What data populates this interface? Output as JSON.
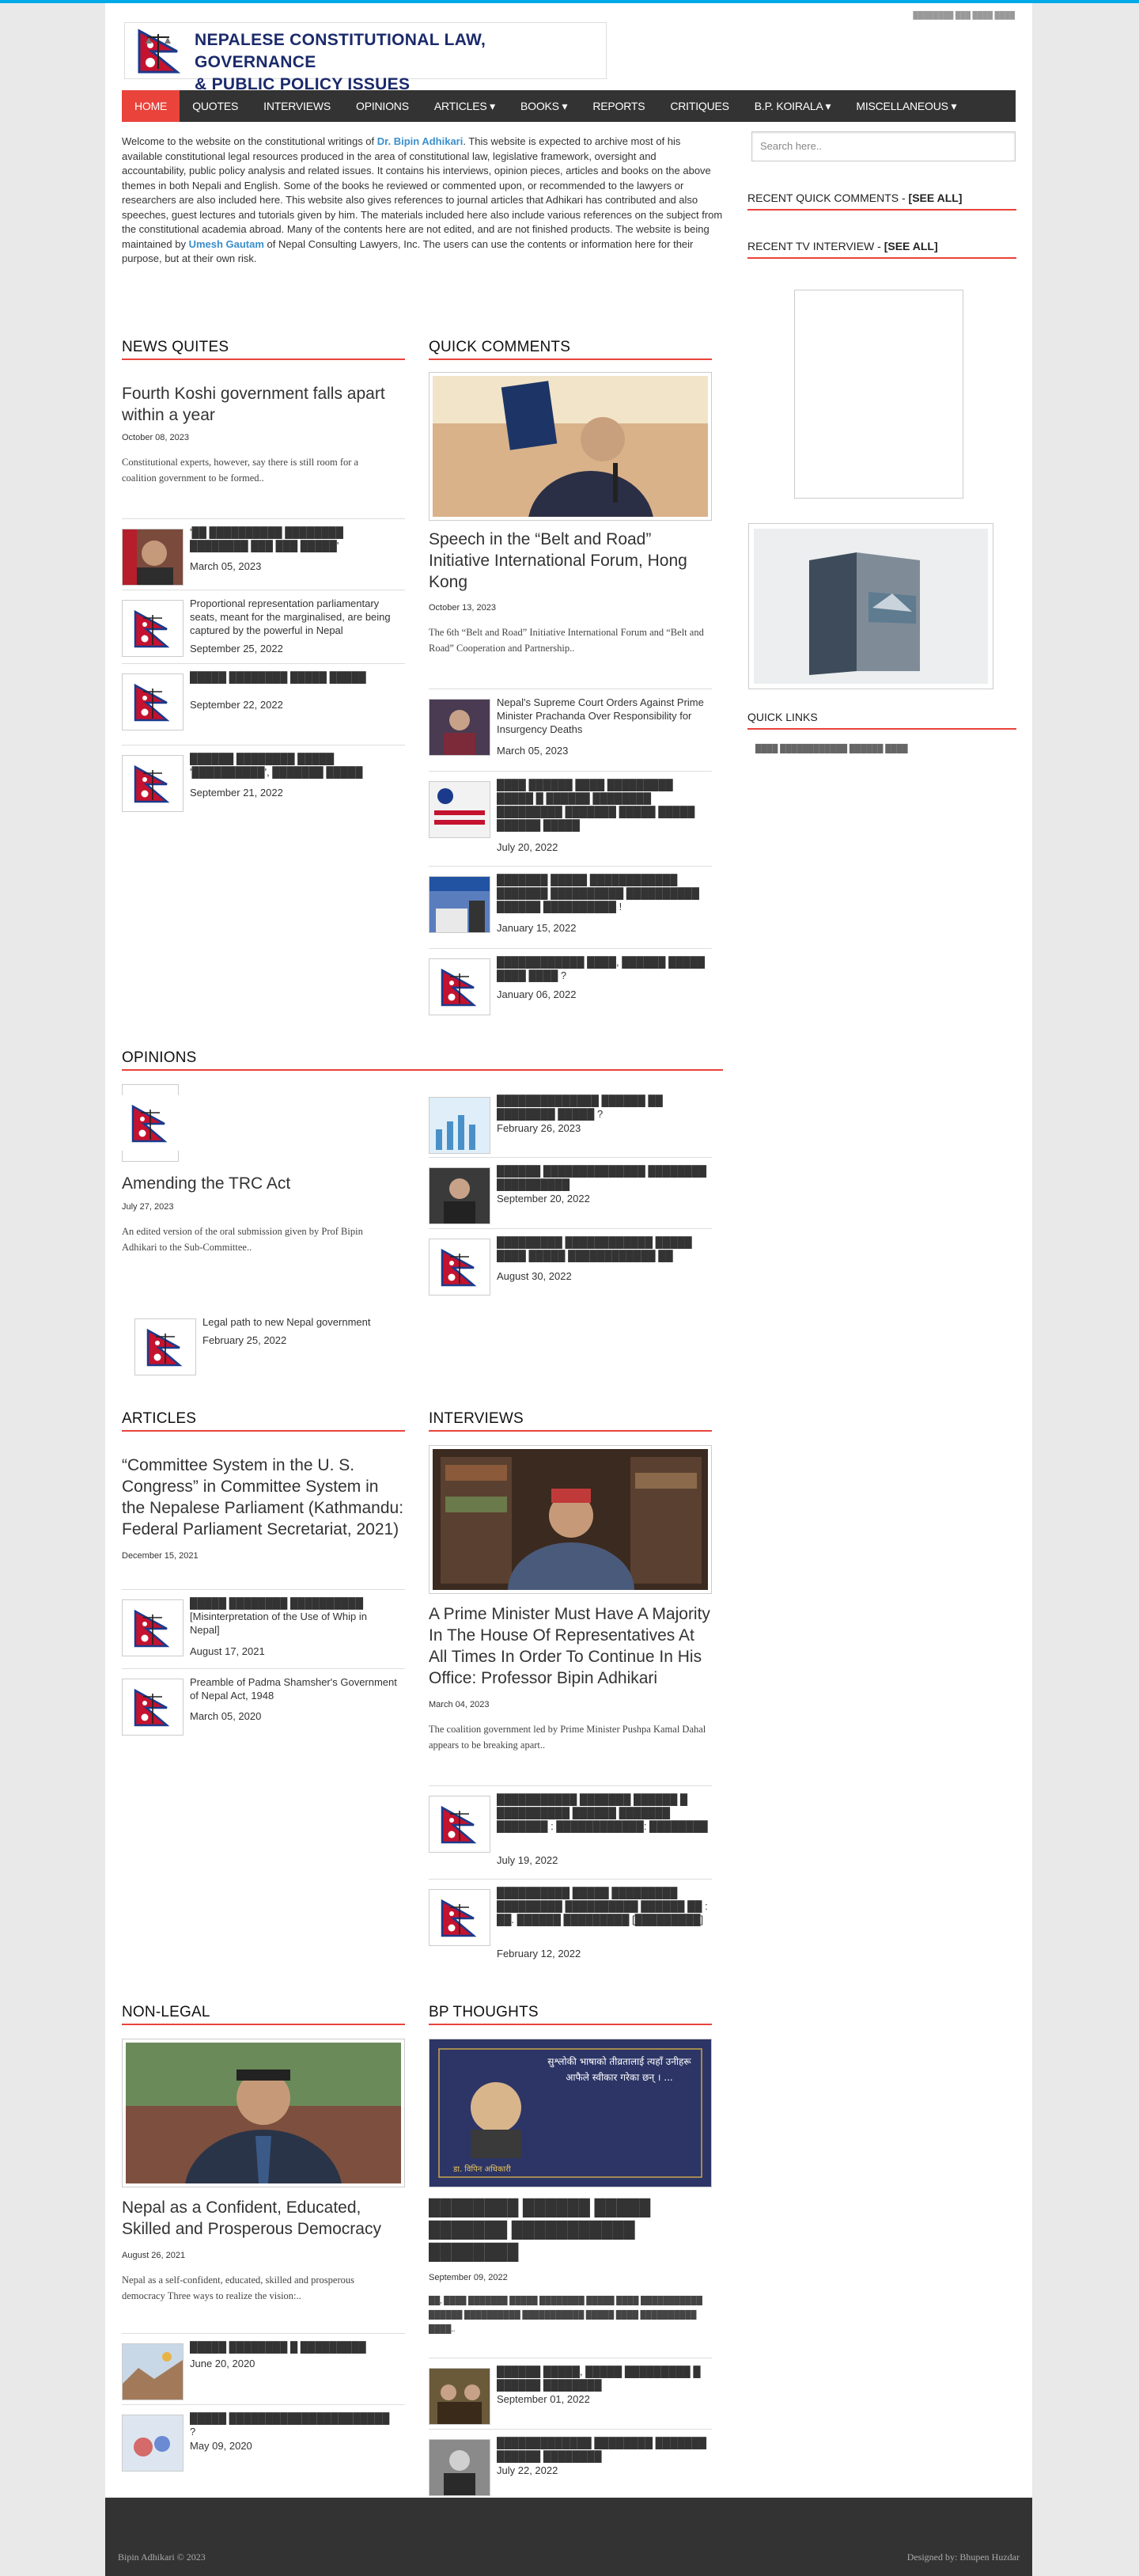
{
  "header": {
    "site_title_line1": "NEPALESE CONSTITUTIONAL LAW, GOVERNANCE",
    "site_title_line2": "& PUBLIC POLICY ISSUES",
    "top_link": "████████ ███ ████ ████"
  },
  "nav": [
    {
      "label": "HOME"
    },
    {
      "label": "QUOTES"
    },
    {
      "label": "INTERVIEWS"
    },
    {
      "label": "OPINIONS"
    },
    {
      "label": "ARTICLES ▾"
    },
    {
      "label": "BOOKS ▾"
    },
    {
      "label": "REPORTS"
    },
    {
      "label": "CRITIQUES"
    },
    {
      "label": "B.P. KOIRALA ▾"
    },
    {
      "label": "MISCELLANEOUS ▾"
    }
  ],
  "intro": {
    "p1": "Welcome to the website on the constitutional writings of ",
    "name": "Dr. Bipin Adhikari",
    "p2": ". This website is expected to archive most of his available constitutional legal resources produced in the area of constitutional law, legislative framework, oversight and accountability, public policy analysis and related issues. It contains his interviews, opinion pieces, articles and books on the above themes in both Nepali and English. Some of the books he reviewed or commented upon, or recommended to the lawyers or researchers are also included here. This website also gives references to journal articles that Adhikari has contributed and also speeches, guest lectures and tutorials given by him. The materials included here also include various references on the subject from the constitutional academia abroad. Many of the contents here are not edited, and are not finished products. The website is being maintained by ",
    "maint": "Umesh Gautam",
    "p3": " of Nepal Consulting Lawyers, Inc. The users can use the contents or information here for their purpose, but at their own risk."
  },
  "sidebar": {
    "search_placeholder": "Search here..",
    "recent_comments": "RECENT QUICK COMMENTS - ",
    "see_all": "[SEE ALL]",
    "recent_tv": "RECENT TV INTERVIEW - ",
    "quick_links": "QUICK LINKS",
    "quick_link_1": "████ ████████████ ██████ ████"
  },
  "news": {
    "heading": "NEWS QUITES",
    "title": "Fourth Koshi government falls apart within a year",
    "date": "October 08, 2023",
    "excerpt": "Constitutional experts, however, say there is still room for a coalition government to be formed..",
    "items": [
      {
        "t": "'██ ██████████ ████████ ████████ ███ ███ █████'",
        "d": "March 05, 2023"
      },
      {
        "t": "Proportional representation parliamentary seats, meant for the marginalised, are being captured by the powerful in Nepal",
        "d": "September 25, 2022"
      },
      {
        "t": "█████ ████████ █████ █████",
        "d": "September 22, 2022"
      },
      {
        "t": "██████ ████████ █████ '██████████', ███████ █████",
        "d": "September 21, 2022"
      }
    ]
  },
  "quick": {
    "heading": "QUICK COMMENTS",
    "title": "Speech in the “Belt and Road” Initiative International Forum, Hong Kong",
    "date": "October 13, 2023",
    "excerpt": "The 6th “Belt and Road” Initiative International Forum and “Belt and Road” Cooperation and Partnership..",
    "items": [
      {
        "t": "Nepal's Supreme Court Orders Against Prime Minister Prachanda Over Responsibility for Insurgency Deaths",
        "d": "March 05, 2023"
      },
      {
        "t": "████ ██████ ████ █████████ █████ █ ██████ ████████ █████████ ███████ █████ █████ ██████ █████",
        "d": "July 20, 2022"
      },
      {
        "t": "███████ █████ ████████████ ███████ ██████████ ██████████ ██████ ██████████ !",
        "d": "January 15, 2022"
      },
      {
        "t": "████████████ ████, ██████ █████ ████ ████ ?",
        "d": "January 06, 2022"
      }
    ]
  },
  "opinions": {
    "heading": "OPINIONS",
    "title": "Amending the TRC Act",
    "date": "July 27, 2023",
    "excerpt": "An edited version of the oral submission given by Prof Bipin Adhikari to the Sub-Committee..",
    "extra": {
      "t": "Legal path to new Nepal government",
      "d": "February 25, 2022"
    },
    "items": [
      {
        "t": "██████████████ ██████ ██ ████████ █████ ?",
        "d": "February 26, 2023"
      },
      {
        "t": "██████ ██████████████ ████████ ██████████",
        "d": "September 20, 2022"
      },
      {
        "t": "█████████ ████████████ █████ ████ █████ ████████████ ██",
        "d": "August 30, 2022"
      }
    ]
  },
  "articles": {
    "heading": "ARTICLES",
    "title": "“Committee System in the U. S. Congress” in Committee System in the Nepalese Parliament (Kathmandu: Federal Parliament Secretariat, 2021)",
    "date": "December 15, 2021",
    "items": [
      {
        "t": "█████ ████████ ██████████ [Misinterpretation of the Use of Whip in Nepal]",
        "d": "August 17, 2021"
      },
      {
        "t": "Preamble of Padma Shamsher's Government of Nepal Act, 1948",
        "d": "March 05, 2020"
      }
    ]
  },
  "interviews": {
    "heading": "INTERVIEWS",
    "title": "A Prime Minister Must Have A Majority In The House Of Representatives At All Times In Order To Continue In His Office: Professor Bipin Adhikari",
    "date": "March 04, 2023",
    "excerpt": "The coalition government led by Prime Minister Pushpa Kamal Dahal appears to be breaking apart..",
    "items": [
      {
        "t": "███████████ ███████ ██████ █ ██████████ ██████ ███████ ███████ : ████████████: ████████",
        "d": "July 19, 2022"
      },
      {
        "t": "██████████ █████ █████████ █████████ ██████████ ██████ ██ : ██. ██████ █████████ [█████████]",
        "d": "February 12, 2022"
      }
    ]
  },
  "nonlegal": {
    "heading": "NON-LEGAL",
    "title": "Nepal as a Confident, Educated, Skilled and Prosperous Democracy",
    "date": "August 26, 2021",
    "excerpt": "Nepal as a self-confident, educated, skilled and prosperous democracy Three ways to realize the vision:..",
    "items": [
      {
        "t": "█████ ████████ █ █████████",
        "d": "June 20, 2020"
      },
      {
        "t": "█████ ██████████████████████ ?",
        "d": "May 09, 2020"
      }
    ]
  },
  "bp": {
    "heading": "BP THOUGHTS",
    "title": "████████ ██████ █████ ███████ ███████████ ████████",
    "date": "September 09, 2022",
    "excerpt": "██, ████ ███████ █████ ████████ █████ ████ ███████████ ██████ ██████████ ███████████ █████ ████ ██████████ ████..",
    "image_quote": "सुश्लोकी भाषाको तीव्रतालाई त्यहाँ उनीहरू आफैले स्वीकार गरेका छन् । ...",
    "image_name": "डा. विपिन अधिकारी",
    "items": [
      {
        "t": "██████ █████, █████ █████████ █ ██████ ████████",
        "d": "September 01, 2022"
      },
      {
        "t": "█████████████ ████████ ███████ ██████ ████████",
        "d": "July 22, 2022"
      }
    ]
  },
  "footer": {
    "left": "Bipin Adhikari  © 2023",
    "right": "Designed by: Bhupen Huzdar"
  },
  "colors": {
    "accent": "#e9433b",
    "nav": "#333333",
    "top": "#00a9e8",
    "link": "#3a8fcc"
  }
}
